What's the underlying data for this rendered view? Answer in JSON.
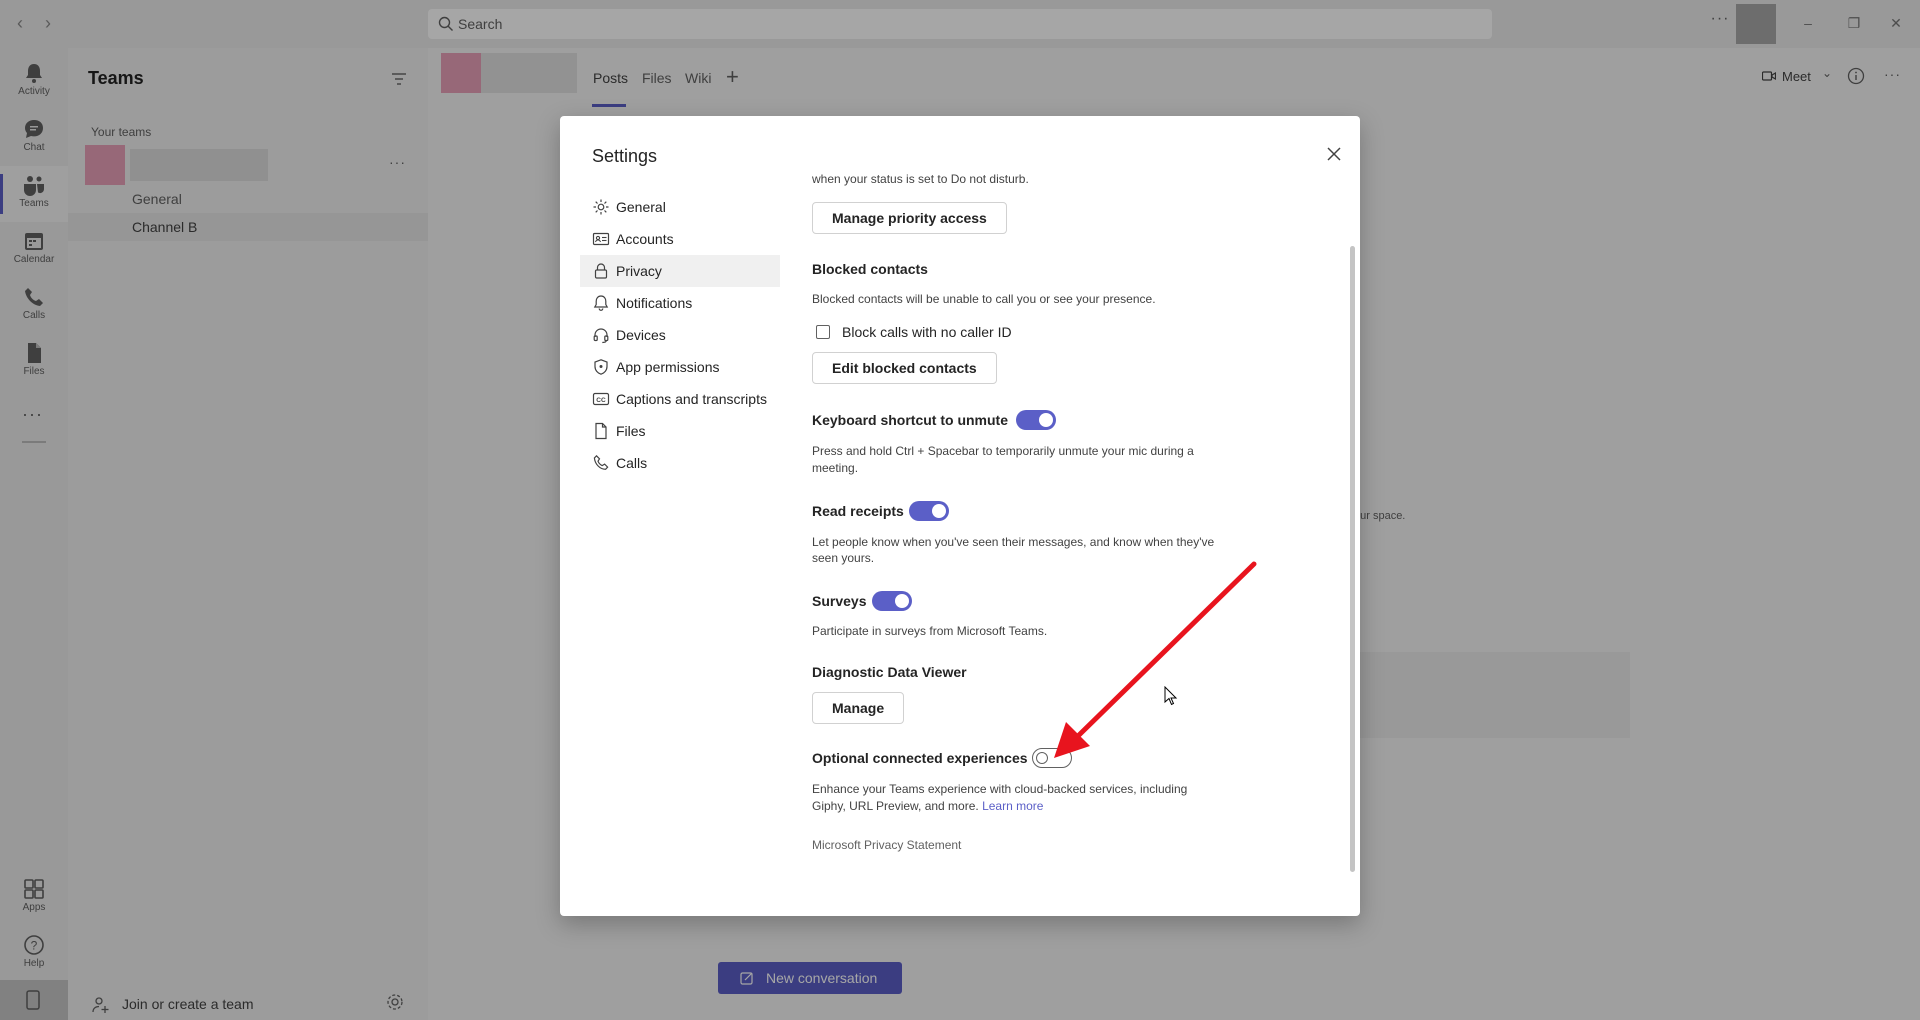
{
  "titlebar": {
    "search_placeholder": "Search",
    "more_label": "···"
  },
  "rail": {
    "items": [
      {
        "label": "Activity",
        "icon": "bell-icon"
      },
      {
        "label": "Chat",
        "icon": "chat-icon"
      },
      {
        "label": "Teams",
        "icon": "teams-icon"
      },
      {
        "label": "Calendar",
        "icon": "calendar-icon"
      },
      {
        "label": "Calls",
        "icon": "phone-icon"
      },
      {
        "label": "Files",
        "icon": "file-icon"
      },
      {
        "label": "Apps",
        "icon": "apps-icon"
      },
      {
        "label": "Help",
        "icon": "help-icon"
      }
    ],
    "more_label": "···"
  },
  "teams_panel": {
    "title": "Teams",
    "section_label": "Your teams",
    "more_label": "···",
    "channels": [
      "General",
      "Channel B"
    ],
    "join_label": "Join or create a team"
  },
  "channel_header": {
    "tabs": [
      "Posts",
      "Files",
      "Wiki"
    ],
    "add_label": "+",
    "meet_label": "Meet",
    "more_label": "···"
  },
  "background": {
    "partial_text": "our space.",
    "new_conversation_label": "New conversation"
  },
  "dialog": {
    "title": "Settings",
    "nav": [
      {
        "label": "General",
        "icon": "gear-icon"
      },
      {
        "label": "Accounts",
        "icon": "id-card-icon"
      },
      {
        "label": "Privacy",
        "icon": "lock-icon"
      },
      {
        "label": "Notifications",
        "icon": "bell-icon"
      },
      {
        "label": "Devices",
        "icon": "headset-icon"
      },
      {
        "label": "App permissions",
        "icon": "shield-icon"
      },
      {
        "label": "Captions and transcripts",
        "icon": "cc-icon"
      },
      {
        "label": "Files",
        "icon": "file-icon"
      },
      {
        "label": "Calls",
        "icon": "phone-icon"
      }
    ],
    "active_nav": "Privacy",
    "content": {
      "dnd_tail_text": "when your status is set to Do not disturb.",
      "manage_priority_label": "Manage priority access",
      "blocked_heading": "Blocked contacts",
      "blocked_desc": "Blocked contacts will be unable to call you or see your presence.",
      "block_no_caller_label": "Block calls with no caller ID",
      "block_no_caller_checked": false,
      "edit_blocked_label": "Edit blocked contacts",
      "keyboard_heading": "Keyboard shortcut to unmute",
      "keyboard_enabled": true,
      "keyboard_desc_1": "Press and hold Ctrl + Spacebar to temporarily unmute your mic during a",
      "keyboard_desc_2": "meeting.",
      "read_receipts_heading": "Read receipts",
      "read_receipts_enabled": true,
      "read_receipts_desc_1": "Let people know when you've seen their messages, and know when they've",
      "read_receipts_desc_2": "seen yours.",
      "surveys_heading": "Surveys",
      "surveys_enabled": true,
      "surveys_desc": "Participate in surveys from Microsoft Teams.",
      "diag_heading": "Diagnostic Data Viewer",
      "manage_label": "Manage",
      "optional_heading": "Optional connected experiences",
      "optional_enabled": false,
      "optional_desc_1": "Enhance your Teams experience with cloud-backed services, including",
      "optional_desc_2": "Giphy, URL Preview, and more.",
      "learn_more_label": "Learn more",
      "privacy_statement_label": "Microsoft Privacy Statement"
    }
  },
  "colors": {
    "accent": "#5b5fc7",
    "annotation_arrow": "#e8141e"
  }
}
